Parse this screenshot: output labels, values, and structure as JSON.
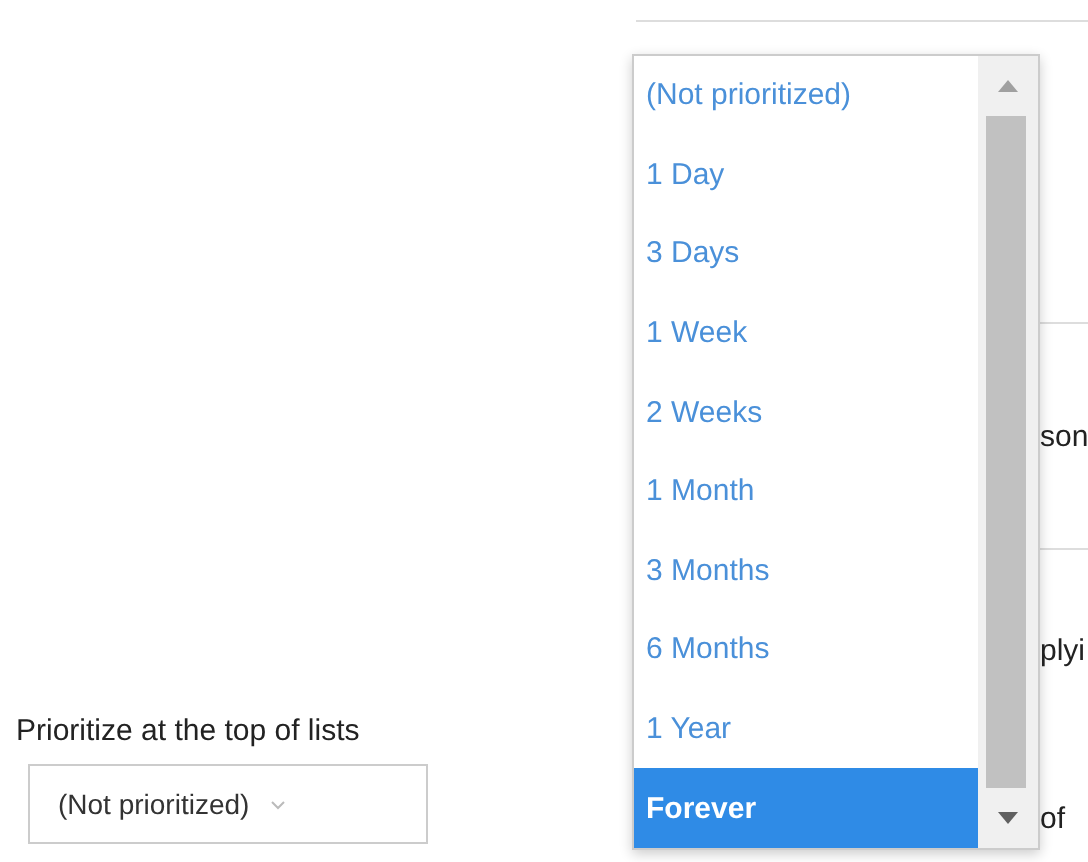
{
  "background_text": [
    "son",
    "plyi",
    "of"
  ],
  "field": {
    "label": "Prioritize at the top of lists",
    "value": "(Not prioritized)"
  },
  "dropdown": {
    "options": [
      {
        "label": "(Not prioritized)",
        "selected": false
      },
      {
        "label": "1 Day",
        "selected": false
      },
      {
        "label": "3 Days",
        "selected": false
      },
      {
        "label": "1 Week",
        "selected": false
      },
      {
        "label": "2 Weeks",
        "selected": false
      },
      {
        "label": "1 Month",
        "selected": false
      },
      {
        "label": "3 Months",
        "selected": false
      },
      {
        "label": "6 Months",
        "selected": false
      },
      {
        "label": "1 Year",
        "selected": false
      },
      {
        "label": "Forever",
        "selected": true
      }
    ]
  }
}
